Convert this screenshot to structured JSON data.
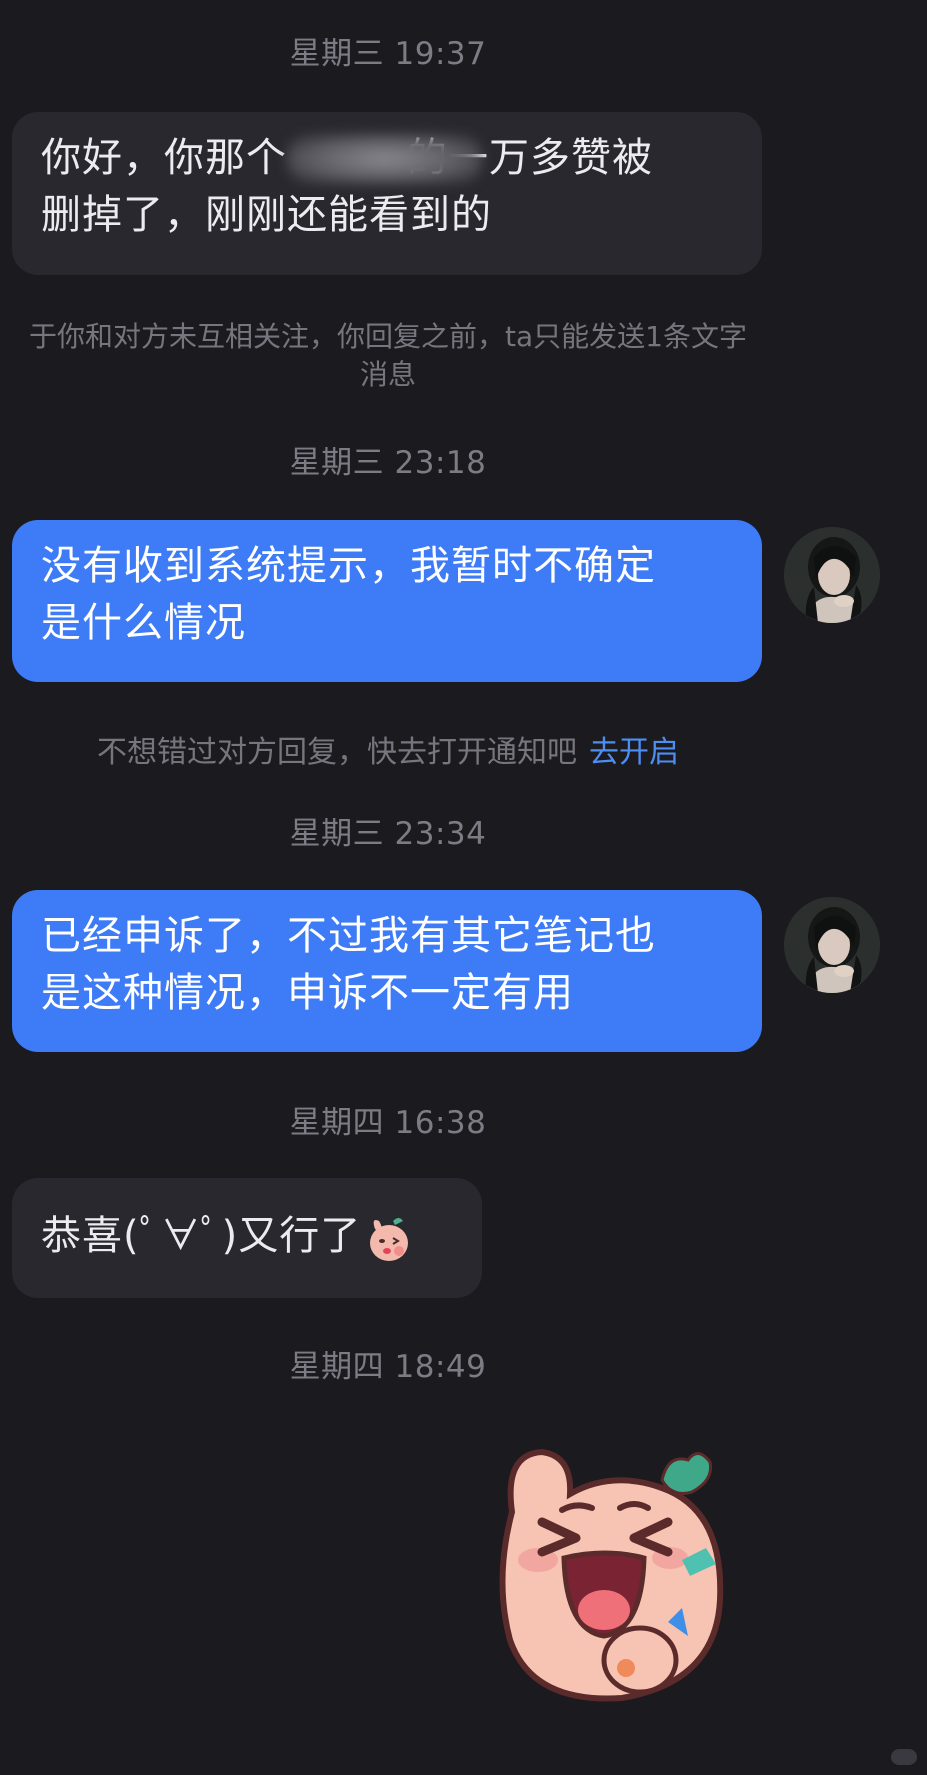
{
  "chat": {
    "timestamps": [
      "星期三 19:37",
      "星期三 23:18",
      "星期三 23:34",
      "星期四 16:38",
      "星期四 18:49"
    ],
    "messages": [
      {
        "line1": "你好，你那个",
        "line1_after": "的一万多赞被",
        "line2": "删掉了，刚刚还能看到的"
      },
      {
        "line1": "没有收到系统提示，我暂时不确定",
        "line2": "是什么情况"
      },
      {
        "line1": "已经申诉了，不过我有其它笔记也",
        "line2": "是这种情况，申诉不一定有用"
      },
      {
        "text": "恭喜(ﾟ∀ﾟ)又行了"
      }
    ],
    "system_note": {
      "line1": "于你和对方未互相关注，你回复之前，ta只能发送1条文字",
      "line2": "消息"
    },
    "notify_banner": {
      "text": "不想错过对方回复，快去打开通知吧",
      "link": "去开启"
    }
  },
  "icons": {
    "small_sticker": "peach-kiss-sticker-icon",
    "big_sticker": "peach-laughing-sticker-icon",
    "avatar": "user-avatar-icon"
  },
  "colors": {
    "background": "#1b1a1f",
    "incoming_bubble": "#29282e",
    "outgoing_bubble": "#3e7bf6",
    "link": "#4d8ef5",
    "muted_text": "#7d7c84"
  }
}
